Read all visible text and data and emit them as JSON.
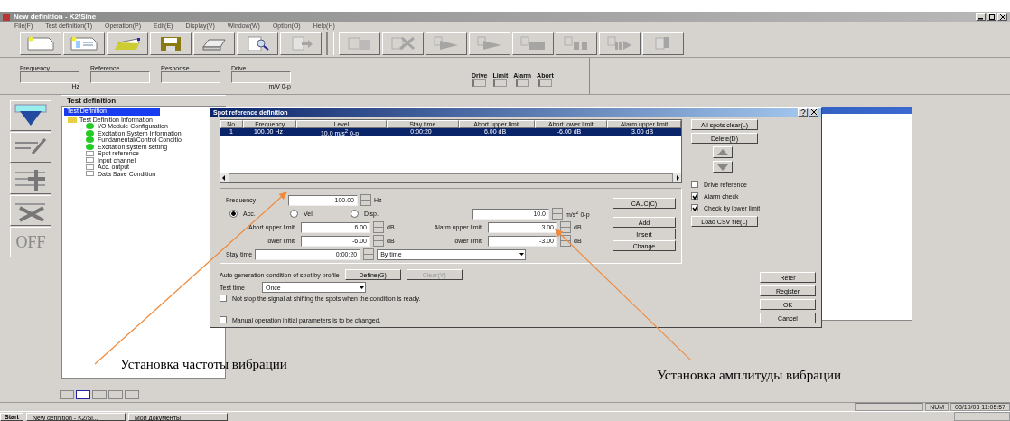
{
  "window": {
    "title": "New definition - K2/Sine"
  },
  "menu": [
    "File(F)",
    "Test definition(T)",
    "Operation(P)",
    "Edit(E)",
    "Display(V)",
    "Window(W)",
    "Option(O)",
    "Help(H)"
  ],
  "toolbar": [
    {
      "kind": "new",
      "disabled": false
    },
    {
      "kind": "open",
      "disabled": false
    },
    {
      "kind": "folder",
      "disabled": false
    },
    {
      "kind": "save",
      "disabled": false
    },
    {
      "kind": "print",
      "disabled": false
    },
    {
      "kind": "preview",
      "disabled": false
    },
    {
      "kind": "export",
      "disabled": true
    },
    {
      "kind": "separator"
    },
    {
      "kind": "setup",
      "disabled": true
    },
    {
      "kind": "clear",
      "disabled": true
    },
    {
      "kind": "run",
      "disabled": true
    },
    {
      "kind": "run",
      "disabled": true
    },
    {
      "kind": "graph",
      "disabled": true
    },
    {
      "kind": "graph2",
      "disabled": true
    },
    {
      "kind": "graph-play",
      "disabled": true
    },
    {
      "kind": "exit",
      "disabled": true
    }
  ],
  "monitor": {
    "fields": [
      {
        "label": "Frequency",
        "unit": "Hz"
      },
      {
        "label": "Reference"
      },
      {
        "label": "Response"
      },
      {
        "label": "Drive",
        "unit": "m/V 0-p"
      }
    ],
    "indicators": [
      {
        "label": "Drive",
        "on": false
      },
      {
        "label": "Limit",
        "on": false
      },
      {
        "label": "Alarm",
        "on": false
      },
      {
        "label": "Abort",
        "on": false
      }
    ]
  },
  "side_tools": [
    {
      "kind": "download"
    },
    {
      "kind": "edit"
    },
    {
      "kind": "add"
    },
    {
      "kind": "delete"
    },
    {
      "kind": "off",
      "label": "OFF"
    }
  ],
  "test_definition": {
    "tab": "Test definition",
    "tree": [
      {
        "label": "Test Definition",
        "selected": true,
        "children": [
          {
            "label": "Test Definition Information",
            "kind": "folder",
            "children": [
              {
                "label": "I/O Module Configuration",
                "done": true
              },
              {
                "label": "Excitation System Information",
                "done": true
              },
              {
                "label": "Fundamental/Control Conditio",
                "done": true
              },
              {
                "label": "Excitation system setting",
                "done": true
              },
              {
                "label": "Spot reference",
                "done": false
              },
              {
                "label": "Input channel",
                "done": false
              },
              {
                "label": "Acc. output",
                "done": false
              },
              {
                "label": "Data Save Condition",
                "done": false
              }
            ]
          }
        ]
      }
    ]
  },
  "dialog": {
    "title": "Spot reference definition",
    "table": {
      "columns": [
        "No.",
        "Frequency",
        "Level",
        "Stay time",
        "Abort upper limit",
        "Abort lower limit",
        "Alarm upper limit"
      ],
      "rows": [
        {
          "selected": true,
          "cells": [
            "1",
            "100.00 Hz",
            "10.0 m/s$^{2}$ 0-p",
            "0:00:20",
            "6.00 dB",
            "-6.00 dB",
            "3.00 dB"
          ]
        }
      ]
    },
    "frequency": {
      "label": "Frequency",
      "value": "100.00",
      "unit": "Hz"
    },
    "modes": [
      {
        "label": "Acc.",
        "selected": true
      },
      {
        "label": "Vel.",
        "selected": false
      },
      {
        "label": "Disp.",
        "selected": false
      }
    ],
    "level": {
      "value": "10.0",
      "unit": "m/s$^{2}$ 0-p"
    },
    "abort_upper": {
      "label": "Abort upper limit",
      "value": "6.00",
      "unit": "dB"
    },
    "abort_lower": {
      "label": "lower limit",
      "value": "-6.00",
      "unit": "dB"
    },
    "alarm_upper": {
      "label": "Alarm upper limit",
      "value": "3.00",
      "unit": "dB"
    },
    "alarm_lower": {
      "label": "lower limit",
      "value": "-3.00",
      "unit": "dB"
    },
    "stay_time": {
      "label": "Stay time",
      "value": "0:00:20",
      "mode": "By time"
    },
    "edit_buttons": [
      "CALC(C)",
      "Add",
      "Insert",
      "Change"
    ],
    "side_buttons": [
      "All spots clear(L)",
      "Delete(D)"
    ],
    "options": [
      {
        "label": "Drive reference",
        "checked": false
      },
      {
        "label": "Alarm check",
        "checked": true
      },
      {
        "label": "Check by lower limit",
        "checked": true
      }
    ],
    "load_button": "Load CSV file(L)",
    "auto": {
      "label": "Auto generation condition of spot by profile",
      "buttons": [
        {
          "label": "Define(G)",
          "disabled": false
        },
        {
          "label": "Clear(Y)",
          "disabled": true
        }
      ]
    },
    "test_time": {
      "label": "Test time",
      "value": "Once"
    },
    "checks": [
      {
        "label": "Not stop the signal at shifting the spots when the condition is ready.",
        "checked": false
      },
      {
        "label": "Manual operation initial parameters is to be changed.",
        "checked": false
      }
    ],
    "buttons": [
      "Refer",
      "Register",
      "OK",
      "Cancel"
    ]
  },
  "page_tabs": [
    {
      "selected": false
    },
    {
      "selected": true
    },
    {
      "selected": false
    },
    {
      "selected": false
    },
    {
      "selected": false
    }
  ],
  "status_bar": {
    "mode": "NUM",
    "datetime": "08/19/03 11:05:57"
  },
  "taskbar": {
    "start": "Start",
    "tasks": [
      "New definition - K2/Si...",
      "Мои документы"
    ]
  },
  "annotations": [
    {
      "text": "Установка частоты вибрации"
    },
    {
      "text": "Установка амплитуды вибрации"
    }
  ]
}
